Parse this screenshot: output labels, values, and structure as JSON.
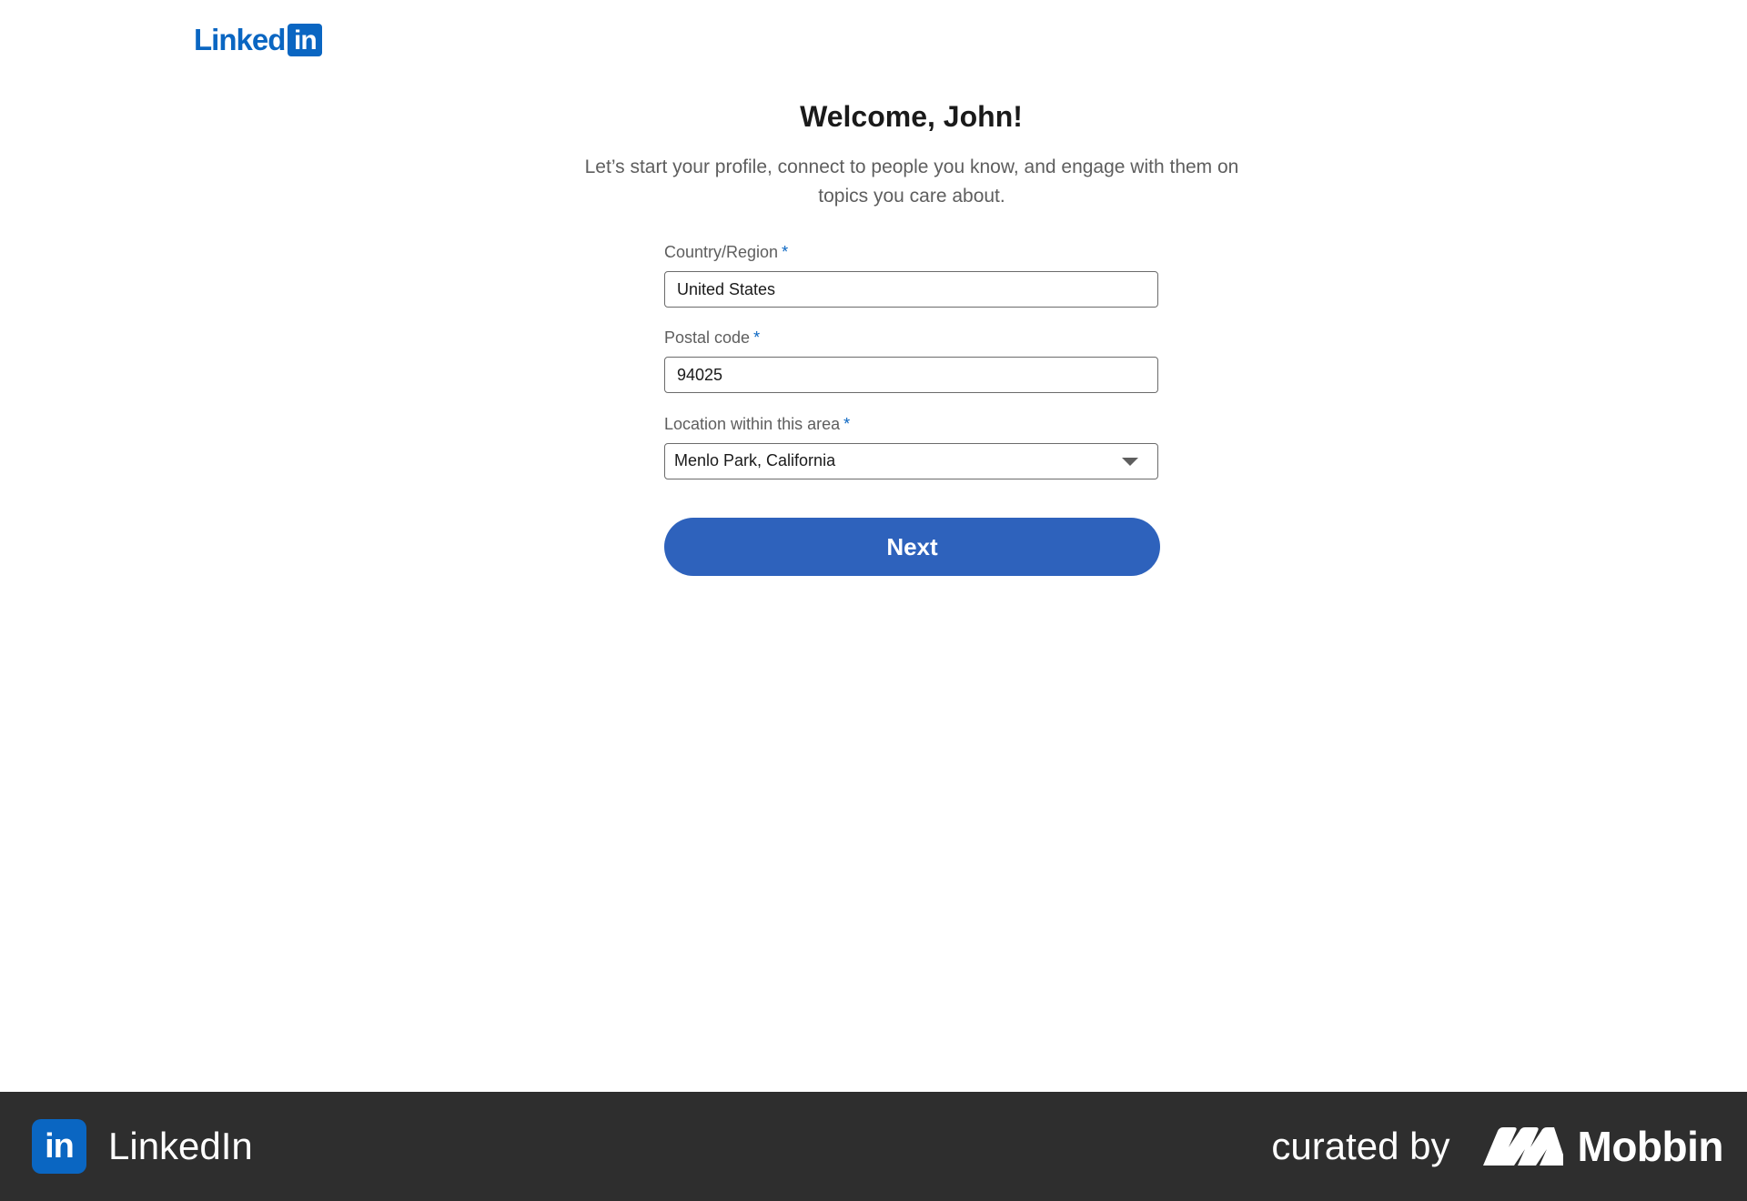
{
  "header": {
    "logo_word": "Linked",
    "logo_box": "in"
  },
  "welcome": {
    "title": "Welcome, John!",
    "subtitle": "Let’s start your profile, connect to people you know, and engage with them on topics you care about."
  },
  "form": {
    "country": {
      "label": "Country/Region",
      "required_mark": "*",
      "value": "United States"
    },
    "postal": {
      "label": "Postal code",
      "required_mark": "*",
      "value": "94025"
    },
    "location": {
      "label": "Location within this area",
      "required_mark": "*",
      "selected": "Menlo Park, California"
    },
    "next_label": "Next"
  },
  "footer": {
    "app_icon_text": "in",
    "app_name": "LinkedIn",
    "credit_text": "curated by",
    "brand_name": "Mobbin"
  },
  "colors": {
    "linkedin_blue": "#0a66c2",
    "button_blue": "#2e62bc",
    "footer_bg": "#2e2e2e"
  }
}
